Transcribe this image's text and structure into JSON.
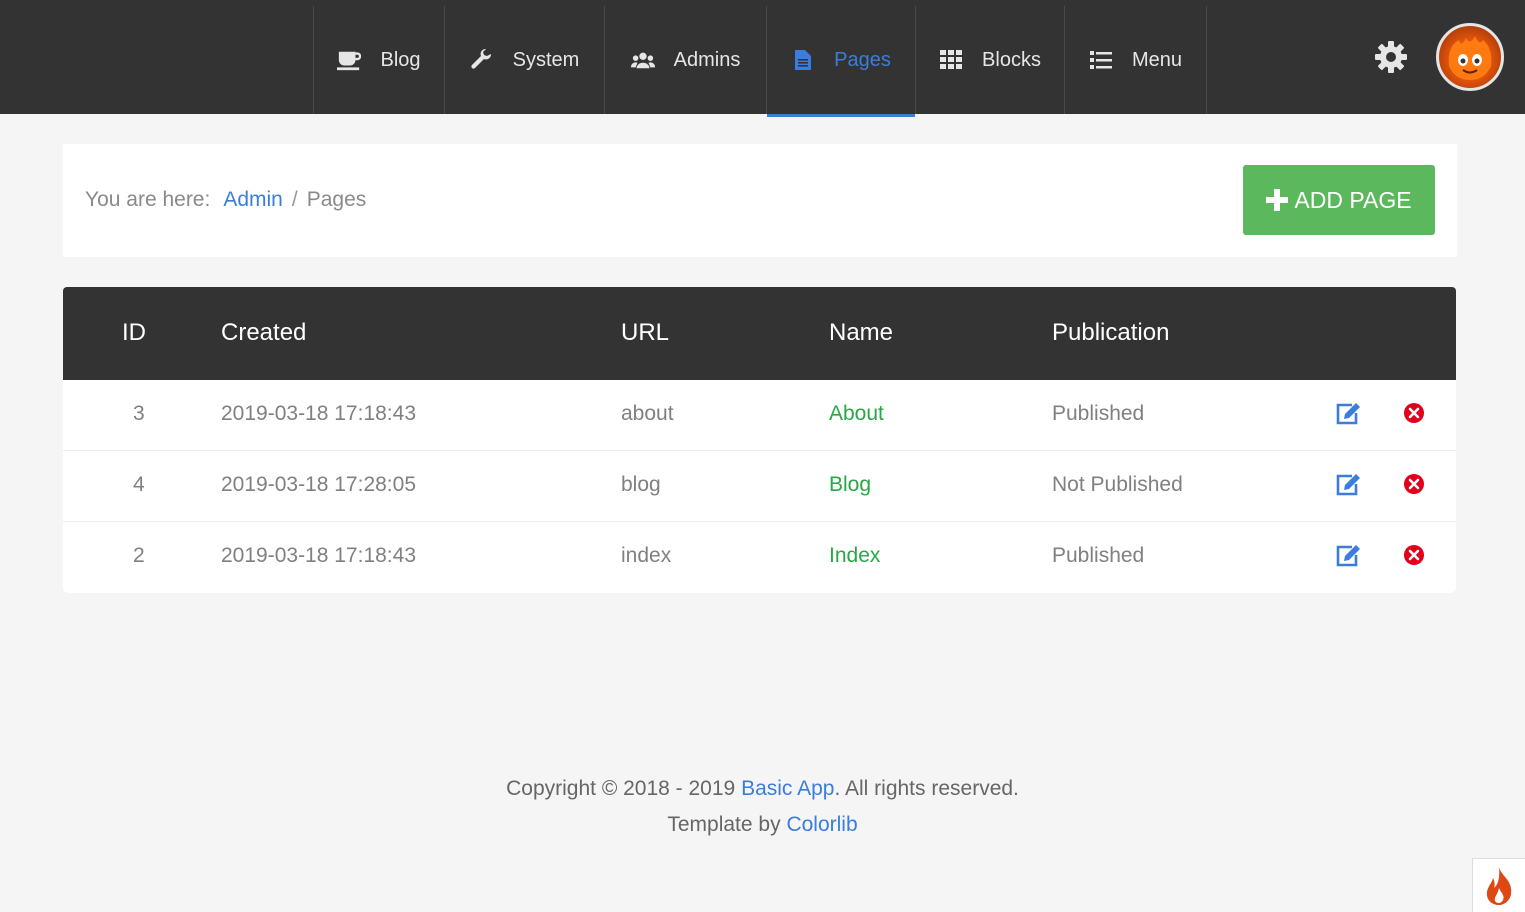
{
  "nav": {
    "items": [
      {
        "label": "Blog",
        "icon": "coffee-icon"
      },
      {
        "label": "System",
        "icon": "wrench-icon"
      },
      {
        "label": "Admins",
        "icon": "users-icon"
      },
      {
        "label": "Pages",
        "icon": "file-icon",
        "active": true
      },
      {
        "label": "Blocks",
        "icon": "grid-icon"
      },
      {
        "label": "Menu",
        "icon": "list-icon"
      }
    ],
    "settings_icon": "gear-icon",
    "avatar": "avatar"
  },
  "breadcrumb": {
    "prefix": "You are here:",
    "admin": "Admin",
    "separator": "/",
    "current": "Pages"
  },
  "add_button": {
    "label": "ADD PAGE",
    "icon": "plus-icon",
    "color": "#5cb85c"
  },
  "table": {
    "headers": [
      "ID",
      "Created",
      "URL",
      "Name",
      "Publication"
    ],
    "rows": [
      {
        "id": "3",
        "created": "2019-03-18 17:18:43",
        "url": "about",
        "name": "About",
        "publication": "Published"
      },
      {
        "id": "4",
        "created": "2019-03-18 17:28:05",
        "url": "blog",
        "name": "Blog",
        "publication": "Not Published"
      },
      {
        "id": "2",
        "created": "2019-03-18 17:18:43",
        "url": "index",
        "name": "Index",
        "publication": "Published"
      }
    ]
  },
  "footer": {
    "copyright_prefix": "Copyright © 2018 - 2019",
    "app_link": "Basic App",
    "copyright_suffix": ". All rights reserved.",
    "template_prefix": "Template by",
    "template_link": "Colorlib"
  },
  "colors": {
    "accent": "#3b7ddd",
    "nav_bg": "#333333",
    "success": "#28a745",
    "danger": "#e3001b"
  }
}
